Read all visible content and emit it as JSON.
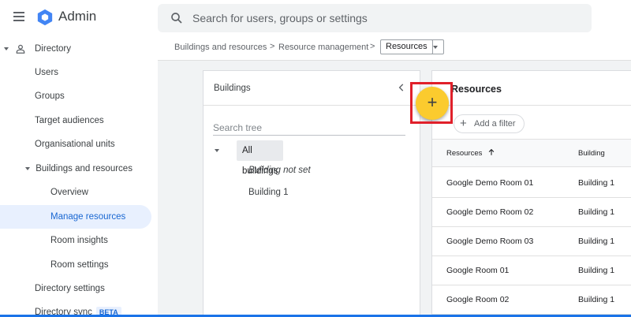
{
  "header": {
    "app_title": "Admin",
    "search_placeholder": "Search for users, groups or settings",
    "menu_icon": "hamburger-menu-icon",
    "logo_icon": "admin-hexagon-logo",
    "search_icon": "search-icon"
  },
  "sidebar": {
    "directory": "Directory",
    "users": "Users",
    "groups": "Groups",
    "target_audiences": "Target audiences",
    "org_units": "Organisational units",
    "buildings_resources": "Buildings and resources",
    "overview": "Overview",
    "manage_resources": "Manage resources",
    "room_insights": "Room insights",
    "room_settings": "Room settings",
    "directory_settings": "Directory settings",
    "directory_sync": "Directory sync",
    "beta_badge": "BETA"
  },
  "breadcrumb": {
    "item1": "Buildings and resources",
    "item2": "Resource management",
    "current": "Resources",
    "separator": ">"
  },
  "buildings_panel": {
    "title": "Buildings",
    "search_placeholder": "Search tree",
    "root": "All buildings",
    "children": [
      "Building not set",
      "Building 1"
    ]
  },
  "resources_panel": {
    "title": "Resources",
    "add_filter": "Add a filter",
    "columns": [
      "Resources",
      "Building"
    ],
    "rows": [
      {
        "name": "Google Demo Room 01",
        "building": "Building 1"
      },
      {
        "name": "Google Demo Room 02",
        "building": "Building 1"
      },
      {
        "name": "Google Demo Room 03",
        "building": "Building 1"
      },
      {
        "name": "Google Room 01",
        "building": "Building 1"
      },
      {
        "name": "Google Room 02",
        "building": "Building 1"
      }
    ]
  },
  "fab": {
    "label": "+"
  },
  "colors": {
    "accent": "#1a73e8",
    "active_nav_bg": "#e8f0fe",
    "fab": "#fbcb2e",
    "highlight": "#e0202a"
  }
}
